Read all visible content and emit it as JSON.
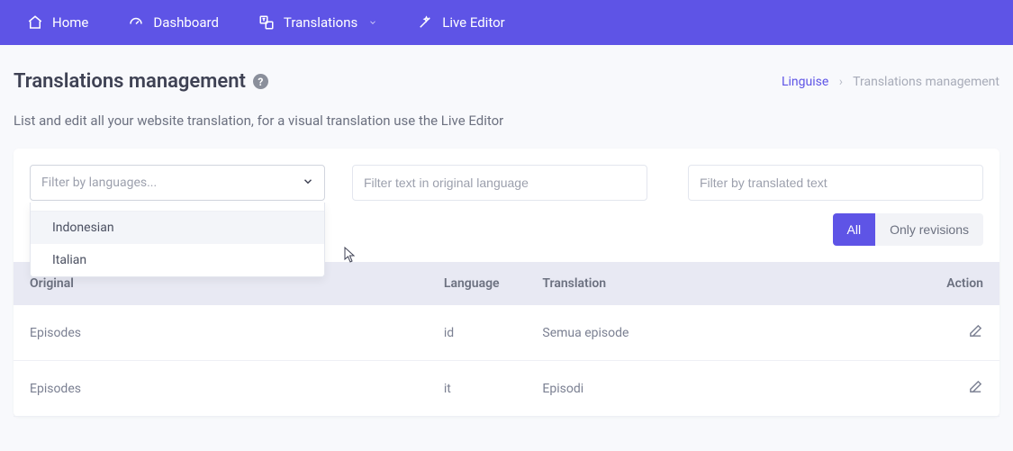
{
  "nav": {
    "home": "Home",
    "dashboard": "Dashboard",
    "translations": "Translations",
    "live_editor": "Live Editor"
  },
  "page": {
    "title": "Translations management",
    "subtitle": "List and edit all your website translation, for a visual translation use the Live Editor"
  },
  "breadcrumbs": {
    "root": "Linguise",
    "current": "Translations management"
  },
  "filters": {
    "language_placeholder": "Filter by languages...",
    "original_placeholder": "Filter text in original language",
    "translated_placeholder": "Filter by translated text",
    "options": [
      "Indonesian",
      "Italian"
    ]
  },
  "toggle": {
    "all": "All",
    "revisions": "Only revisions"
  },
  "table": {
    "headers": {
      "original": "Original",
      "language": "Language",
      "translation": "Translation",
      "action": "Action"
    },
    "rows": [
      {
        "original": "Episodes",
        "language": "id",
        "translation": "Semua episode"
      },
      {
        "original": "Episodes",
        "language": "it",
        "translation": "Episodi"
      }
    ]
  }
}
